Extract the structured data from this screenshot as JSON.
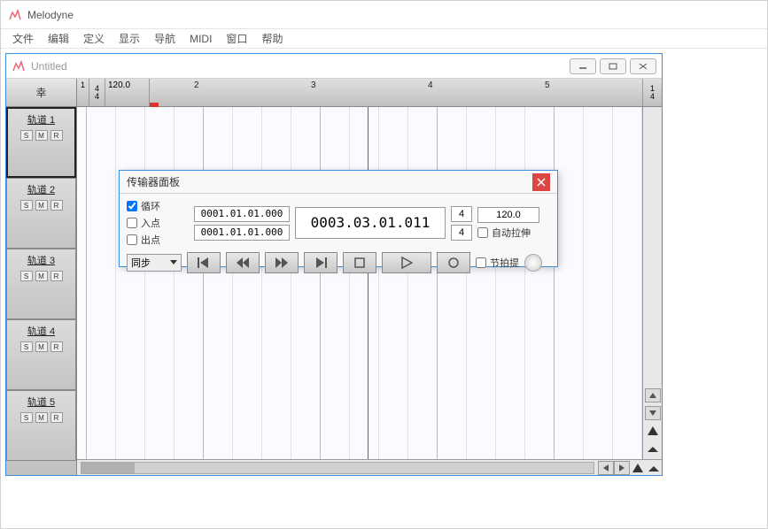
{
  "app": {
    "title": "Melodyne"
  },
  "menu": [
    "文件",
    "编辑",
    "定义",
    "显示",
    "导航",
    "MIDI",
    "窗口",
    "帮助"
  ],
  "doc": {
    "title": "Untitled"
  },
  "ruler": {
    "bar_start": "1",
    "time_sig_top": "4",
    "time_sig_bottom": "4",
    "tempo": "120.0",
    "bars": [
      "2",
      "3",
      "4",
      "5"
    ],
    "right_top": "1",
    "right_bottom": "4"
  },
  "tracks": [
    {
      "name": "轨道 1",
      "selected": true
    },
    {
      "name": "轨道 2",
      "selected": false
    },
    {
      "name": "轨道 3",
      "selected": false
    },
    {
      "name": "轨道 4",
      "selected": false
    },
    {
      "name": "轨道 5",
      "selected": false
    }
  ],
  "track_header": "幸",
  "track_btns": {
    "s": "S",
    "m": "M",
    "r": "R"
  },
  "transport": {
    "title": "传输器面板",
    "loop_label": "循环",
    "loop_checked": true,
    "in_label": "入点",
    "in_checked": false,
    "out_label": "出点",
    "out_checked": false,
    "pos1": "0001.01.01.000",
    "pos2": "0001.01.01.000",
    "big_pos": "0003.03.01.011",
    "sig_top": "4",
    "sig_bottom": "4",
    "tempo": "120.0",
    "autostretch_label": "自动拉伸",
    "autostretch_checked": false,
    "sync_label": "同步",
    "click_label": "节拍提",
    "click_checked": false
  }
}
